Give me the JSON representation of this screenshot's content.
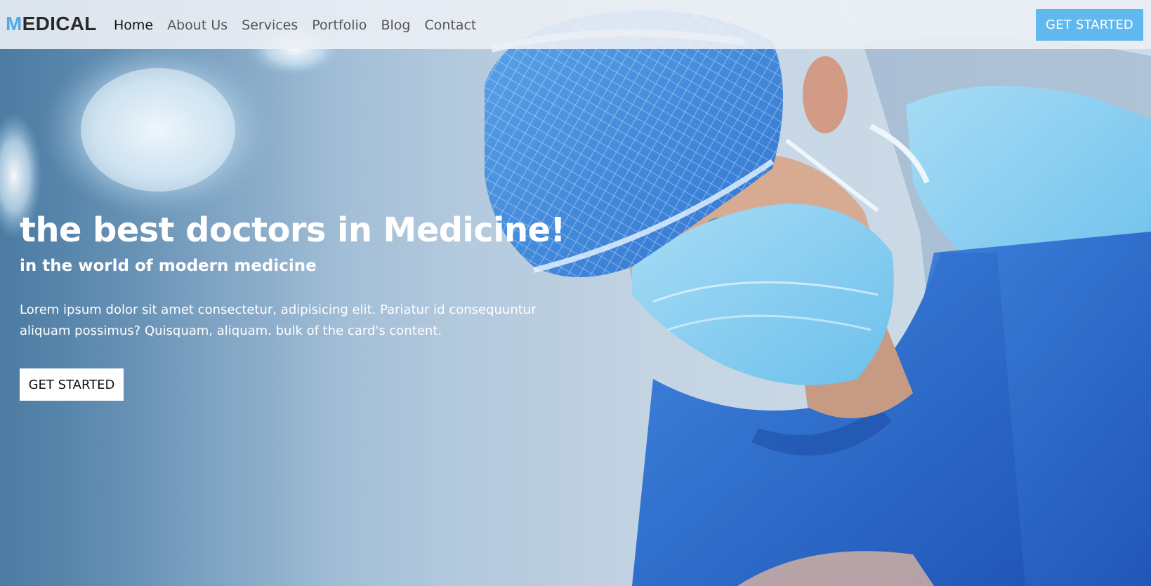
{
  "brand": {
    "logo_first": "M",
    "logo_rest": "EDICAL"
  },
  "nav": {
    "items": [
      {
        "label": "Home",
        "active": true
      },
      {
        "label": "About Us"
      },
      {
        "label": "Services"
      },
      {
        "label": "Portfolio"
      },
      {
        "label": "Blog"
      },
      {
        "label": "Contact"
      }
    ],
    "cta_label": "GET STARTED"
  },
  "hero": {
    "title_part1": "the best doctors in",
    "title_part2": "Medicine!",
    "subtitle": "in the world of modern medicine",
    "text": "Lorem ipsum dolor sit amet consectetur, adipisicing elit. Pariatur id consequuntur aliquam possimus? Quisquam, aliquam. bulk of the card's content.",
    "cta_label": "GET STARTED"
  },
  "colors": {
    "accent": "#5fb9ef",
    "logo_accent": "#4ea9e6",
    "scrubs": "#2d6fd0"
  }
}
